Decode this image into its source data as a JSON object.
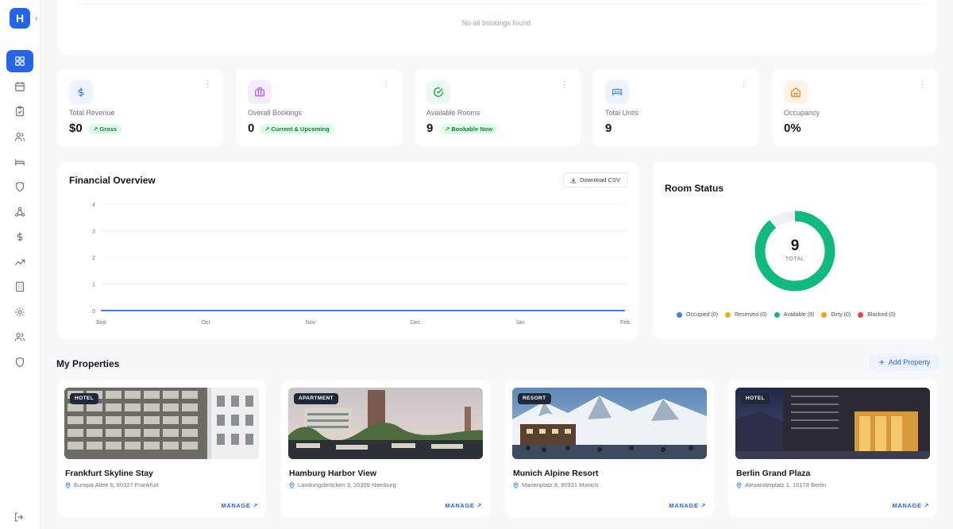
{
  "app": {
    "logo_letter": "H"
  },
  "sidebar": {
    "items": [
      {
        "icon": "grid-icon",
        "active": true
      },
      {
        "icon": "calendar-icon"
      },
      {
        "icon": "clipboard-check-icon"
      },
      {
        "icon": "users-icon"
      },
      {
        "icon": "bed-icon"
      },
      {
        "icon": "shield-icon"
      },
      {
        "icon": "chemistry-icon"
      },
      {
        "icon": "dollar-icon"
      },
      {
        "icon": "trending-up-icon"
      },
      {
        "icon": "building-icon"
      },
      {
        "icon": "gear-icon"
      },
      {
        "icon": "users-icon"
      },
      {
        "icon": "shield-icon"
      }
    ],
    "logout_icon": "logout-icon"
  },
  "bookings": {
    "empty_text": "No all bookings found."
  },
  "stats": [
    {
      "label": "Total Revenue",
      "value": "$0",
      "badge": "↗ Gross",
      "icon": "dollar-icon",
      "color": "#3b82f6",
      "bg": "#eef4ff"
    },
    {
      "label": "Overall Bookings",
      "value": "0",
      "badge": "↗ Current & Upcoming",
      "icon": "briefcase-icon",
      "color": "#a855f7",
      "bg": "#f5edff"
    },
    {
      "label": "Available Rooms",
      "value": "9",
      "badge": "↗ Bookable Now",
      "icon": "check-circle-icon",
      "color": "#16a34a",
      "bg": "#eafaf0"
    },
    {
      "label": "Total Units",
      "value": "9",
      "badge": "",
      "icon": "bed-icon",
      "color": "#3b82f6",
      "bg": "#eef4ff"
    },
    {
      "label": "Occupancy",
      "value": "0%",
      "badge": "",
      "icon": "home-icon",
      "color": "#ea7a12",
      "bg": "#fff3e6"
    }
  ],
  "financial": {
    "title": "Financial Overview",
    "download_label": "Download CSV"
  },
  "chart_data": {
    "type": "line",
    "title": "Financial Overview",
    "categories": [
      "Sep",
      "Oct",
      "Nov",
      "Dec",
      "Jan",
      "Feb"
    ],
    "y_ticks": [
      "0",
      "1",
      "2",
      "3",
      "4"
    ],
    "ylim": [
      0,
      4
    ],
    "series": [
      {
        "values": [
          0,
          0,
          0,
          0,
          0,
          0
        ],
        "color": "#3b82f6"
      }
    ],
    "grid": true
  },
  "room_status": {
    "title": "Room Status",
    "total": "9",
    "total_label": "TOTAL",
    "available_fraction": 0.889,
    "legend": [
      {
        "label": "Occupied (0)",
        "color": "#3b82f6"
      },
      {
        "label": "Reserved (0)",
        "color": "#eab308"
      },
      {
        "label": "Available (8)",
        "color": "#10b981"
      },
      {
        "label": "Dirty (0)",
        "color": "#f59e0b"
      },
      {
        "label": "Blocked (0)",
        "color": "#ef4444"
      }
    ]
  },
  "properties": {
    "title": "My Properties",
    "add_label": "Add Property",
    "items": [
      {
        "type": "HOTEL",
        "name": "Frankfurt Skyline Stay",
        "address": "Europa-Allee 6, 60327 Frankfurt",
        "manage": "MANAGE ↗"
      },
      {
        "type": "APARTMENT",
        "name": "Hamburg Harbor View",
        "address": "Landungsbrücken 3, 20359 Hamburg",
        "manage": "MANAGE ↗"
      },
      {
        "type": "RESORT",
        "name": "Munich Alpine Resort",
        "address": "Marienplatz 8, 80331 Munich",
        "manage": "MANAGE ↗"
      },
      {
        "type": "HOTEL",
        "name": "Berlin Grand Plaza",
        "address": "Alexanderplatz 1, 10178 Berlin",
        "manage": "MANAGE ↗"
      }
    ]
  }
}
